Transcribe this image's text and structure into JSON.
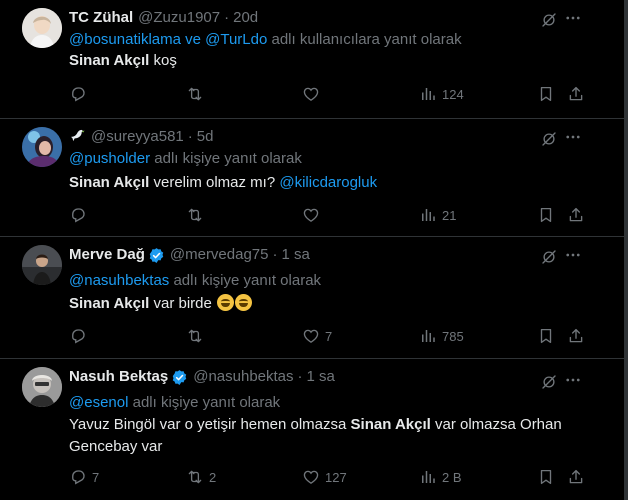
{
  "tweets": [
    {
      "name": "TC Zühal",
      "handle": "@Zuzu1907",
      "dot": "·",
      "time": "20d",
      "reply_mentions": "@bosunatiklama ve @TurLdo",
      "reply_suffix": " adlı kullanıcılara yanıt olarak",
      "body_bold": "Sinan Akçıl",
      "body_rest": " koş",
      "counts": {
        "reply": "",
        "retweet": "",
        "like": "",
        "views": "124"
      }
    },
    {
      "name": "",
      "handle": "@sureyya581",
      "dot": "·",
      "time": "5d",
      "reply_mentions": "@pusholder",
      "reply_suffix": " adlı kişiye yanıt olarak",
      "body_bold": "Sinan Akçıl",
      "body_rest": " verelim olmaz mı? ",
      "body_link": "@kilicdarogluk",
      "counts": {
        "reply": "",
        "retweet": "",
        "like": "",
        "views": "21"
      }
    },
    {
      "name": "Merve Dağ",
      "handle": "@mervedag75",
      "dot": "·",
      "time": "1 sa",
      "reply_mentions": "@nasuhbektas",
      "reply_suffix": " adlı kişiye yanıt olarak",
      "body_bold": "Sinan Akçıl",
      "body_rest": " var birde ",
      "counts": {
        "reply": "",
        "retweet": "",
        "like": "7",
        "views": "785"
      }
    },
    {
      "name": "Nasuh Bektaş",
      "handle": "@nasuhbektas",
      "dot": "·",
      "time": "1 sa",
      "reply_mentions": "@esenol",
      "reply_suffix": " adlı kişiye yanıt olarak",
      "body_pre": "Yavuz Bingöl var o yetişir hemen olmazsa ",
      "body_bold": "Sinan Akçıl",
      "body_rest": " var olmazsa Orhan Gencebay var",
      "counts": {
        "reply": "7",
        "retweet": "2",
        "like": "127",
        "views": "2 B"
      }
    }
  ],
  "icons": {
    "reply": "reply-icon",
    "retweet": "retweet-icon",
    "like": "heart-icon",
    "views": "views-icon",
    "bookmark": "bookmark-icon",
    "share": "share-icon",
    "grok": "grok-icon",
    "more": "more-icon",
    "verified": "verified-badge-icon",
    "dove": "dove-emoji-icon",
    "emoji": "grinning-sweat-emoji-icon"
  },
  "colors": {
    "background": "#000000",
    "text": "#e7e9ea",
    "muted": "#71767b",
    "link": "#1d9bf0",
    "divider": "#2f3336"
  }
}
